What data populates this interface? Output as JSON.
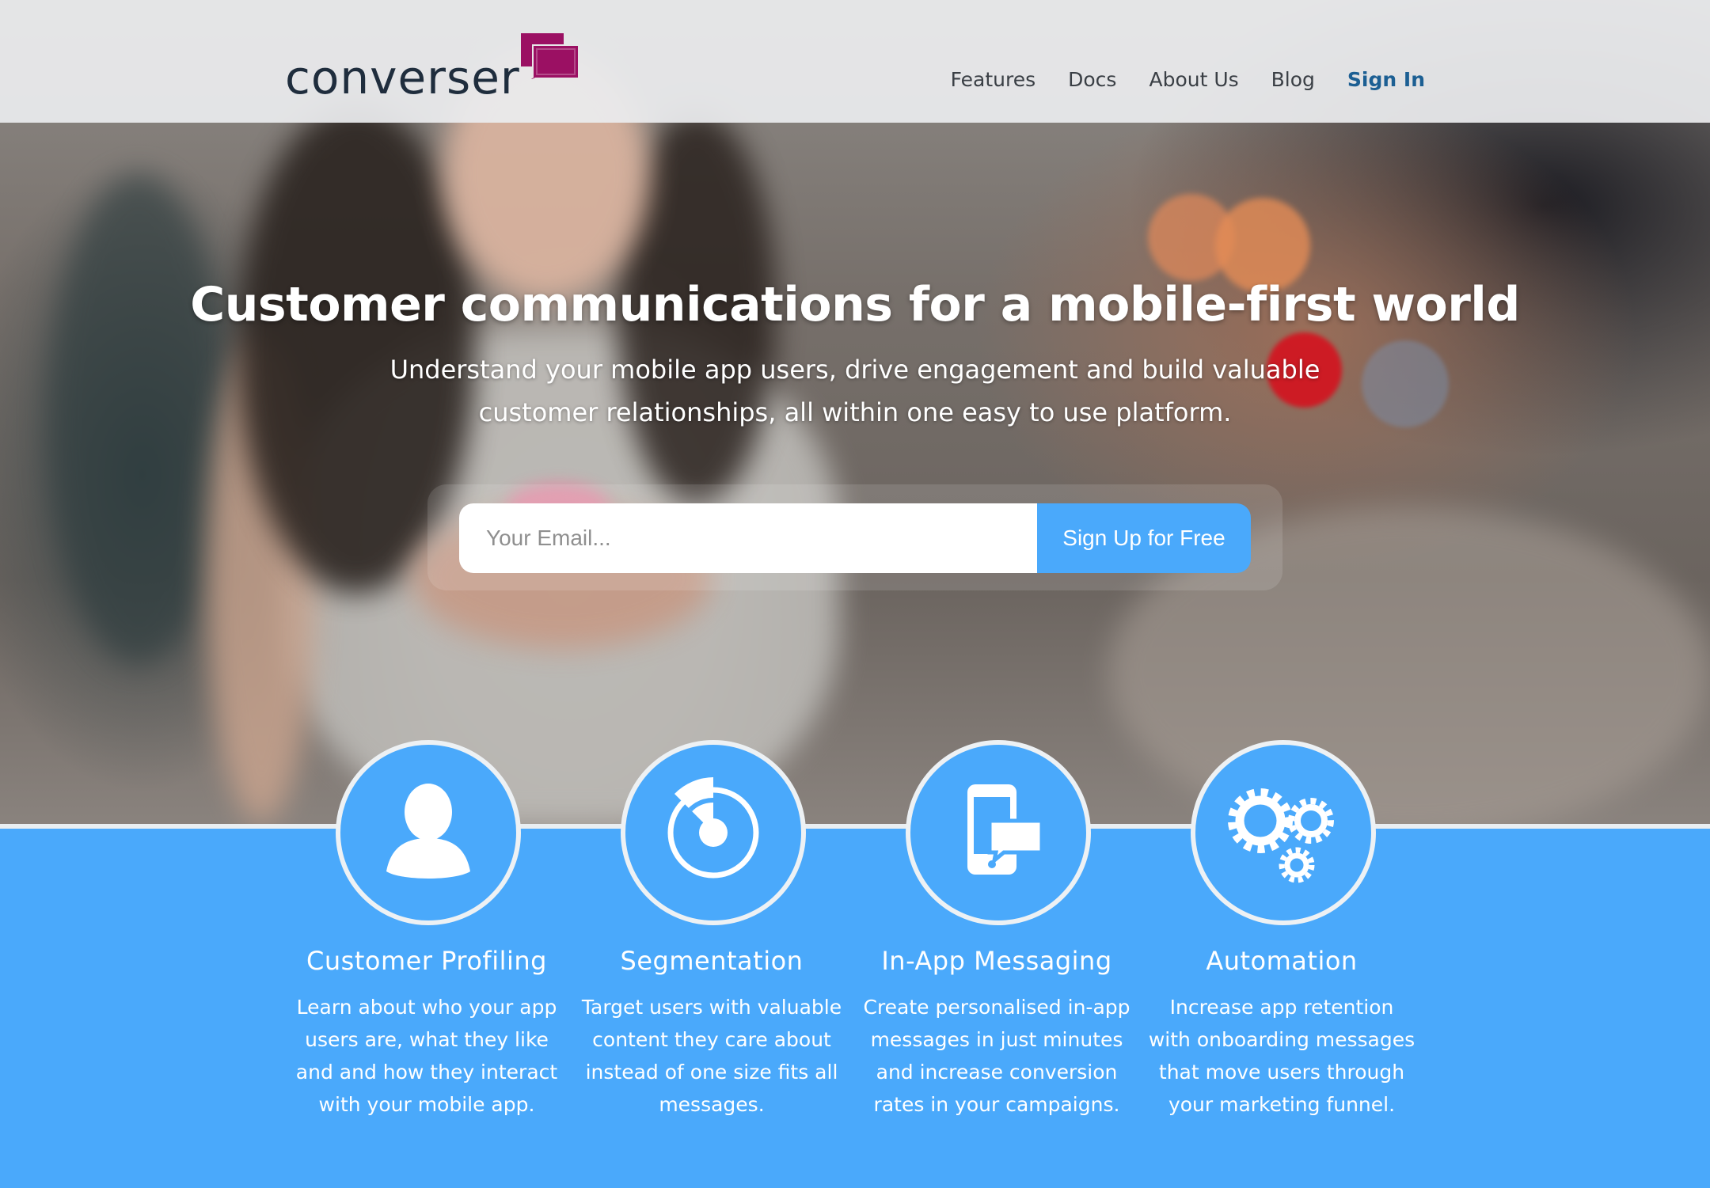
{
  "brand": {
    "name": "converser",
    "logo_color": "#1f2d3d",
    "mark_color": "#9b1063",
    "accent": "#4aa9fb"
  },
  "nav": {
    "items": [
      {
        "label": "Features"
      },
      {
        "label": "Docs"
      },
      {
        "label": "About Us"
      },
      {
        "label": "Blog"
      }
    ],
    "signin_label": "Sign In"
  },
  "hero": {
    "headline": "Customer communications for a mobile-first world",
    "subhead": "Understand your mobile app users, drive engagement and build valuable customer relationships, all within one easy to use platform.",
    "email_placeholder": "Your Email...",
    "signup_label": "Sign Up for Free"
  },
  "features": [
    {
      "icon": "user-icon",
      "title": "Customer Profiling",
      "description": "Learn about who your app users are, what they like and and how they interact with your mobile app."
    },
    {
      "icon": "target-icon",
      "title": "Segmentation",
      "description": "Target users with valuable content they care about instead of one size fits all messages."
    },
    {
      "icon": "mobile-message-icon",
      "title": "In-App Messaging",
      "description": "Create personalised in-app messages in just minutes and increase conversion rates in your campaigns."
    },
    {
      "icon": "gears-icon",
      "title": "Automation",
      "description": "Increase app retention with onboarding messages that move users through your marketing funnel."
    }
  ]
}
